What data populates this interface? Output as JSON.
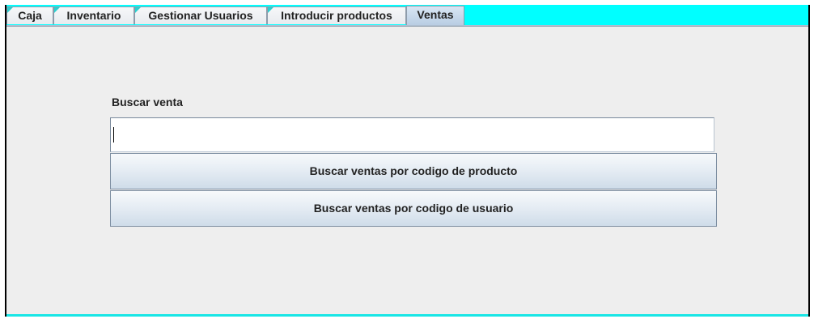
{
  "tabs": [
    {
      "label": "Caja",
      "selected": false
    },
    {
      "label": "Inventario",
      "selected": false
    },
    {
      "label": "Gestionar Usuarios",
      "selected": false
    },
    {
      "label": "Introducir productos",
      "selected": false
    },
    {
      "label": "Ventas",
      "selected": true
    }
  ],
  "ventas": {
    "search_label": "Buscar venta",
    "search_value": "",
    "button_by_product": "Buscar ventas por codigo de producto",
    "button_by_user": "Buscar ventas por codigo de usuario"
  },
  "colors": {
    "tabbar_background": "#00ffff",
    "panel_background": "#eeeeee",
    "selected_tab": "#c8d9ec"
  }
}
